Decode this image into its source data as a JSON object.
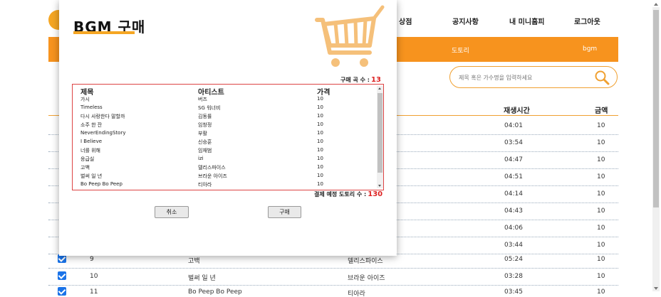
{
  "nav": {
    "items": [
      "상점",
      "공지사항",
      "내 미니홈피",
      "로그아웃"
    ]
  },
  "subnav": {
    "items": [
      "도토리",
      "bgm"
    ]
  },
  "search": {
    "placeholder": "제목 혹은 가수명을 입력하세요"
  },
  "table": {
    "headers": {
      "time": "재생시간",
      "price": "금액"
    },
    "rows": [
      {
        "time": "04:01",
        "price": "10"
      },
      {
        "time": "03:54",
        "price": "10"
      },
      {
        "time": "04:47",
        "price": "10"
      },
      {
        "time": "04:51",
        "price": "10"
      },
      {
        "time": "04:14",
        "price": "10"
      },
      {
        "time": "04:43",
        "price": "10"
      },
      {
        "time": "04:06",
        "price": "10"
      },
      {
        "time": "03:44",
        "price": "10"
      },
      {
        "num": "9",
        "title": "고백",
        "artist": "델리스파이스",
        "time": "05:24",
        "price": "10"
      },
      {
        "num": "10",
        "title": "벌써 일 년",
        "artist": "브라운 아이즈",
        "time": "03:28",
        "price": "10"
      },
      {
        "num": "11",
        "title": "Bo Peep Bo Peep",
        "artist": "티아라",
        "time": "03:45",
        "price": "10"
      }
    ]
  },
  "modal": {
    "title": "BGM 구매",
    "count_label": "구매 곡 수 :",
    "count_value": "13",
    "headers": {
      "title": "제목",
      "artist": "아티스트",
      "price": "가격"
    },
    "songs": [
      {
        "title": "가시",
        "artist": "버즈",
        "price": "10"
      },
      {
        "title": "Timeless",
        "artist": "SG 워너비",
        "price": "10"
      },
      {
        "title": "다시 사랑한다 말할까",
        "artist": "김동률",
        "price": "10"
      },
      {
        "title": "소주 한 잔",
        "artist": "임창정",
        "price": "10"
      },
      {
        "title": "NeverEndingStory",
        "artist": "부활",
        "price": "10"
      },
      {
        "title": "I Believe",
        "artist": "신승훈",
        "price": "10"
      },
      {
        "title": "너를 위해",
        "artist": "임재범",
        "price": "10"
      },
      {
        "title": "응급실",
        "artist": "izi",
        "price": "10"
      },
      {
        "title": "고백",
        "artist": "델리스파이스",
        "price": "10"
      },
      {
        "title": "벌써 일 년",
        "artist": "브라운 아이즈",
        "price": "10"
      },
      {
        "title": "Bo Peep Bo Peep",
        "artist": "티아라",
        "price": "10"
      }
    ],
    "remaining_label": "결제 예정 도토리 수 :",
    "remaining_value": "130",
    "cancel_label": "취소",
    "buy_label": "구매"
  },
  "colors": {
    "accent": "#f7931e",
    "cart": "#f5c07a",
    "checkbox": "#1a73e8",
    "highlight_red": "#d22"
  },
  "icons": {
    "cart": "shopping-cart-icon",
    "search": "magnifier-icon",
    "check": "checkbox-checked-icon"
  }
}
